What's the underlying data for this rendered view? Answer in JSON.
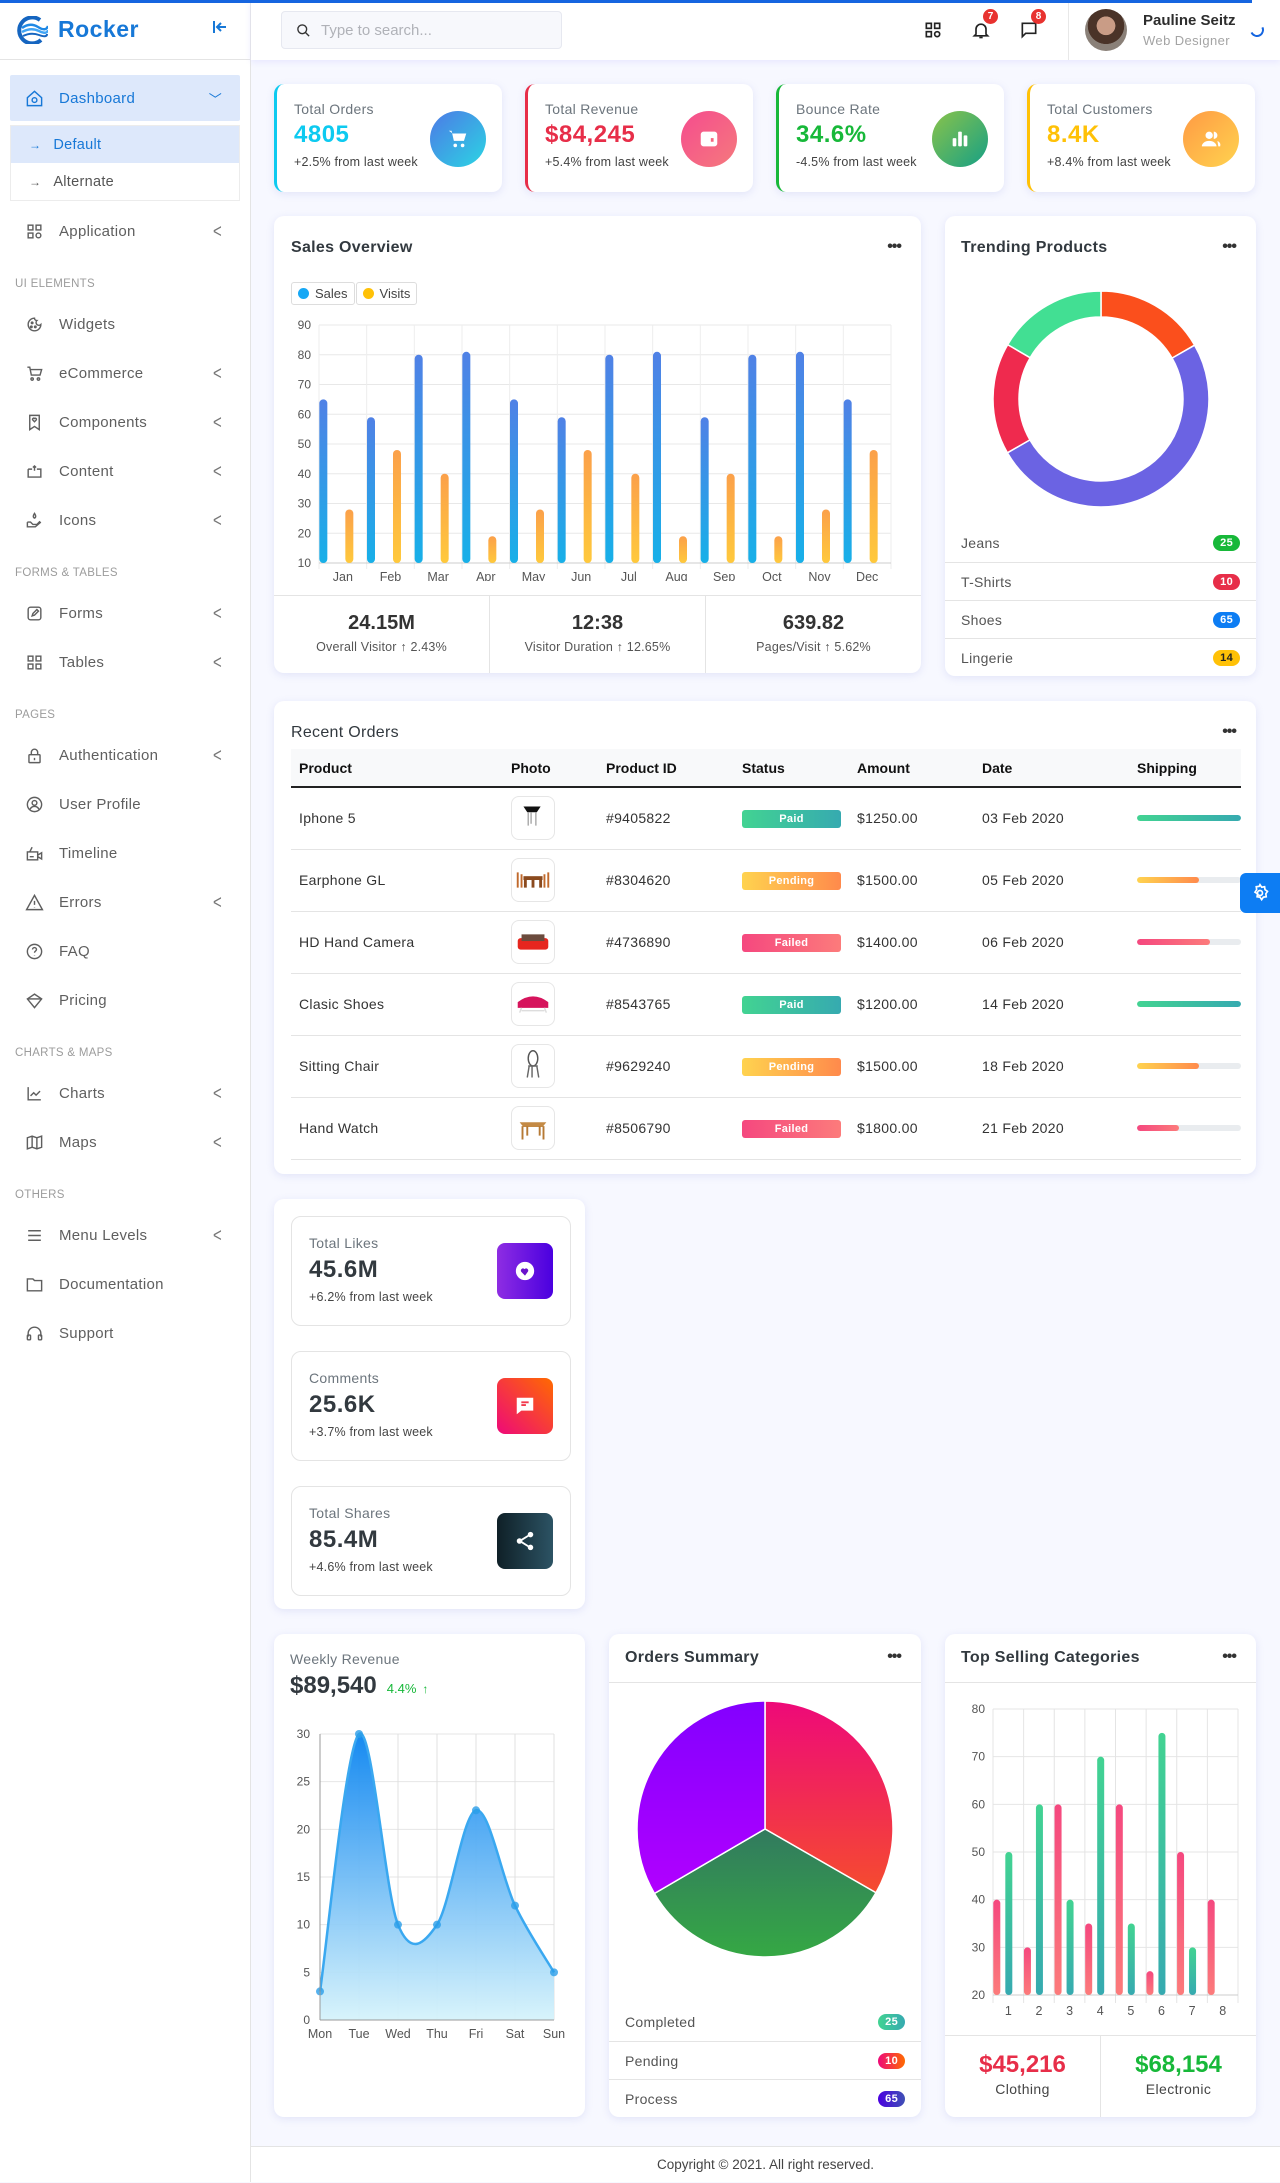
{
  "brand": {
    "name": "Rocker"
  },
  "search": {
    "placeholder": "Type to search..."
  },
  "header": {
    "notifications_count": "7",
    "messages_count": "8",
    "user_name": "Pauline Seitz",
    "user_role": "Web Designer"
  },
  "sidebar": {
    "dashboard": {
      "label": "Dashboard",
      "sub": [
        {
          "label": "Default"
        },
        {
          "label": "Alternate"
        }
      ]
    },
    "items": [
      {
        "label": "Application",
        "icon": "apps-icon",
        "chevron": true
      },
      {
        "section": "UI ELEMENTS"
      },
      {
        "label": "Widgets",
        "icon": "cookie-icon",
        "chevron": false
      },
      {
        "label": "eCommerce",
        "icon": "cart-icon",
        "chevron": true
      },
      {
        "label": "Components",
        "icon": "bookmark-heart-icon",
        "chevron": true
      },
      {
        "label": "Content",
        "icon": "repeat-icon",
        "chevron": true
      },
      {
        "label": "Icons",
        "icon": "donate-icon",
        "chevron": true
      },
      {
        "section": "FORMS & TABLES"
      },
      {
        "label": "Forms",
        "icon": "edit-icon",
        "chevron": true
      },
      {
        "label": "Tables",
        "icon": "grid-icon",
        "chevron": true
      },
      {
        "section": "PAGES"
      },
      {
        "label": "Authentication",
        "icon": "lock-icon",
        "chevron": true
      },
      {
        "label": "User Profile",
        "icon": "user-circle-icon",
        "chevron": false
      },
      {
        "label": "Timeline",
        "icon": "video-icon",
        "chevron": false
      },
      {
        "label": "Errors",
        "icon": "error-icon",
        "chevron": true
      },
      {
        "label": "FAQ",
        "icon": "help-icon",
        "chevron": false
      },
      {
        "label": "Pricing",
        "icon": "diamond-icon",
        "chevron": false
      },
      {
        "section": "CHARTS & MAPS"
      },
      {
        "label": "Charts",
        "icon": "line-chart-icon",
        "chevron": true
      },
      {
        "label": "Maps",
        "icon": "map-icon",
        "chevron": true
      },
      {
        "section": "OTHERS"
      },
      {
        "label": "Menu Levels",
        "icon": "menu-icon",
        "chevron": true
      },
      {
        "label": "Documentation",
        "icon": "folder-icon",
        "chevron": false
      },
      {
        "label": "Support",
        "icon": "headphone-icon",
        "chevron": false
      }
    ]
  },
  "stats": [
    {
      "title": "Total Orders",
      "value": "4805",
      "sub": "+2.5% from last week",
      "color": "#0dcaf0",
      "icon": "cart-icon"
    },
    {
      "title": "Total Revenue",
      "value": "$84,245",
      "sub": "+5.4% from last week",
      "color": "#e72e49",
      "icon": "wallet-icon"
    },
    {
      "title": "Bounce Rate",
      "value": "34.6%",
      "sub": "-4.5% from last week",
      "color": "#17b839",
      "icon": "bar-chart-icon"
    },
    {
      "title": "Total Customers",
      "value": "8.4K",
      "sub": "+8.4% from last week",
      "color": "#ffc107",
      "icon": "group-icon"
    }
  ],
  "sales_overview": {
    "title": "Sales Overview",
    "summary": [
      {
        "value": "24.15M",
        "label": "Overall Visitor ↑ 2.43%"
      },
      {
        "value": "12:38",
        "label": "Visitor Duration ↑ 12.65%"
      },
      {
        "value": "639.82",
        "label": "Pages/Visit ↑ 5.62%"
      }
    ]
  },
  "trending": {
    "title": "Trending Products",
    "items": [
      {
        "label": "Jeans",
        "value": "25",
        "color": "#17b839"
      },
      {
        "label": "T-Shirts",
        "value": "10",
        "color": "#e72e49"
      },
      {
        "label": "Shoes",
        "value": "65",
        "color": "#0d7df3"
      },
      {
        "label": "Lingerie",
        "value": "14",
        "color": "#ffc107"
      }
    ]
  },
  "orders": {
    "title": "Recent Orders",
    "columns": [
      "Product",
      "Photo",
      "Product ID",
      "Status",
      "Amount",
      "Date",
      "Shipping"
    ],
    "rows": [
      {
        "product": "Iphone 5",
        "photo": "chair-black",
        "id": "#9405822",
        "status": "Paid",
        "amount": "$1250.00",
        "date": "03 Feb 2020",
        "shipping": 100
      },
      {
        "product": "Earphone GL",
        "photo": "dining-set",
        "id": "#8304620",
        "status": "Pending",
        "amount": "$1500.00",
        "date": "05 Feb 2020",
        "shipping": 60
      },
      {
        "product": "HD Hand Camera",
        "photo": "red-sofa",
        "id": "#4736890",
        "status": "Failed",
        "amount": "$1400.00",
        "date": "06 Feb 2020",
        "shipping": 70
      },
      {
        "product": "Clasic Shoes",
        "photo": "pink-sofa",
        "id": "#8543765",
        "status": "Paid",
        "amount": "$1200.00",
        "date": "14 Feb 2020",
        "shipping": 100
      },
      {
        "product": "Sitting Chair",
        "photo": "bentwood-chair",
        "id": "#9629240",
        "status": "Pending",
        "amount": "$1500.00",
        "date": "18 Feb 2020",
        "shipping": 60
      },
      {
        "product": "Hand Watch",
        "photo": "wood-table",
        "id": "#8506790",
        "status": "Failed",
        "amount": "$1800.00",
        "date": "21 Feb 2020",
        "shipping": 40
      }
    ]
  },
  "social": [
    {
      "title": "Total Likes",
      "value": "45.6M",
      "sub": "+6.2% from last week",
      "icon": "heart-icon"
    },
    {
      "title": "Comments",
      "value": "25.6K",
      "sub": "+3.7% from last week",
      "icon": "comment-icon"
    },
    {
      "title": "Total Shares",
      "value": "85.4M",
      "sub": "+4.6% from last week",
      "icon": "share-icon"
    }
  ],
  "weekly": {
    "title": "Weekly Revenue",
    "value": "$89,540",
    "change": "4.4%"
  },
  "orders_summary": {
    "title": "Orders Summary",
    "items": [
      {
        "label": "Completed",
        "value": "25"
      },
      {
        "label": "Pending",
        "value": "10"
      },
      {
        "label": "Process",
        "value": "65"
      }
    ]
  },
  "top_selling": {
    "title": "Top Selling Categories",
    "footer": [
      {
        "value": "$45,216",
        "label": "Clothing",
        "color": "#e72e49"
      },
      {
        "value": "$68,154",
        "label": "Electronic",
        "color": "#17b839"
      }
    ]
  },
  "footer": {
    "text": "Copyright © 2021. All right reserved."
  },
  "chart_data": [
    {
      "id": "sales-overview",
      "type": "bar",
      "title": "Sales Overview",
      "categories": [
        "Jan",
        "Feb",
        "Mar",
        "Apr",
        "May",
        "Jun",
        "Jul",
        "Aug",
        "Sep",
        "Oct",
        "Nov",
        "Dec"
      ],
      "series": [
        {
          "name": "Sales",
          "values": [
            65,
            59,
            80,
            81,
            65,
            59,
            80,
            81,
            59,
            80,
            81,
            65
          ]
        },
        {
          "name": "Visits",
          "values": [
            28,
            48,
            40,
            19,
            28,
            48,
            40,
            19,
            40,
            19,
            28,
            48
          ]
        }
      ],
      "yticks": [
        10,
        20,
        30,
        40,
        50,
        60,
        70,
        80,
        90
      ],
      "ylim": [
        10,
        90
      ],
      "grid": true,
      "legend": "top-left"
    },
    {
      "id": "trending-products",
      "type": "pie",
      "subtype": "donut",
      "title": "Trending Products",
      "note": "slice shares estimated from visual angles",
      "slices": [
        {
          "color": "orange",
          "share": 16.7
        },
        {
          "color": "purple",
          "share": 50
        },
        {
          "color": "red",
          "share": 16.7
        },
        {
          "color": "green",
          "share": 16.6
        }
      ]
    },
    {
      "id": "weekly-revenue",
      "type": "area",
      "title": "Weekly Revenue",
      "x": [
        "Mon",
        "Tue",
        "Wed",
        "Thu",
        "Fri",
        "Sat",
        "Sun"
      ],
      "values": [
        3,
        30,
        10,
        10,
        22,
        12,
        5
      ],
      "yticks": [
        0,
        5,
        10,
        15,
        20,
        25,
        30
      ],
      "ylim": [
        0,
        30
      ],
      "grid": true
    },
    {
      "id": "orders-summary",
      "type": "pie",
      "title": "Orders Summary",
      "slices": [
        {
          "label": "Pending",
          "share": 33.3
        },
        {
          "label": "Completed",
          "share": 33.3
        },
        {
          "label": "Process",
          "share": 33.4
        }
      ]
    },
    {
      "id": "top-selling",
      "type": "bar",
      "title": "Top Selling Categories",
      "categories": [
        "1",
        "2",
        "3",
        "4",
        "5",
        "6",
        "7",
        "8"
      ],
      "series": [
        {
          "name": "Clothing",
          "values": [
            40,
            30,
            60,
            35,
            60,
            25,
            50,
            40
          ]
        },
        {
          "name": "Electronic",
          "values": [
            50,
            60,
            40,
            70,
            35,
            75,
            30,
            null
          ]
        }
      ],
      "yticks": [
        20,
        30,
        40,
        50,
        60,
        70,
        80
      ],
      "ylim": [
        20,
        80
      ],
      "grid": true
    }
  ]
}
